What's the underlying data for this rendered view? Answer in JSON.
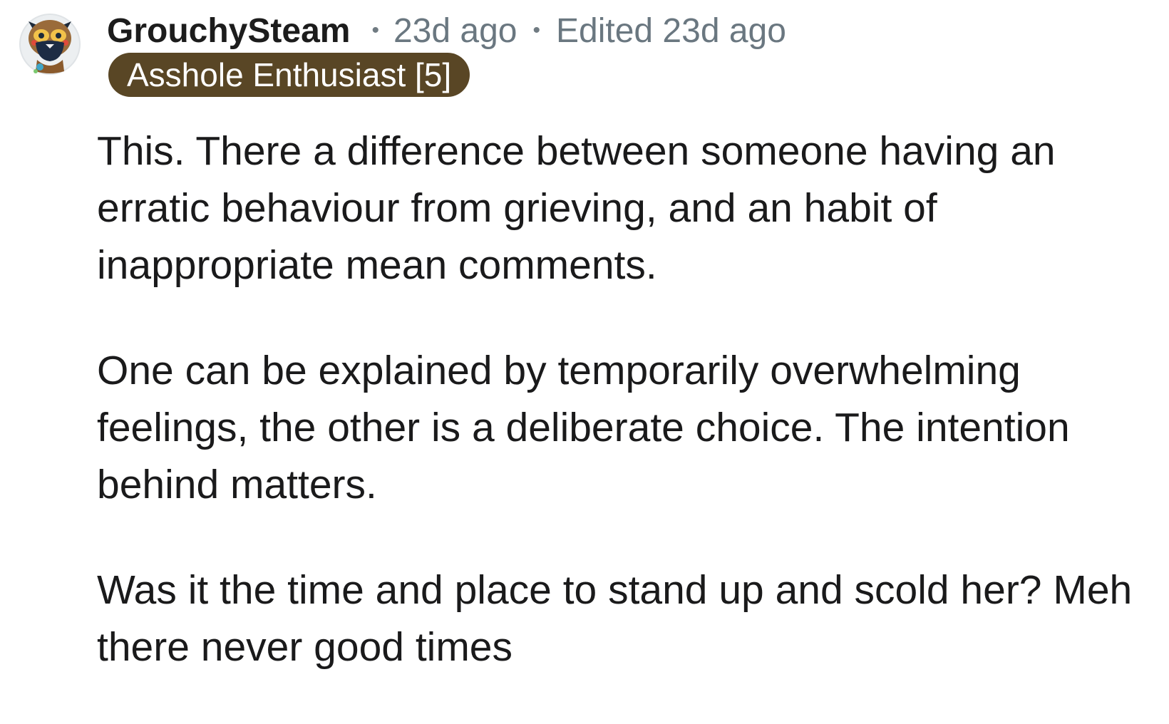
{
  "comment": {
    "author": "GrouchySteam",
    "avatar_icon": "owl-avatar-icon",
    "separator": "•",
    "posted": "23d ago",
    "edited": "Edited 23d ago",
    "flair": "Asshole Enthusiast [5]",
    "paragraphs": [
      "This. There a difference between someone having an erratic behaviour from grieving, and an habit of inappropriate mean comments.",
      "One can be explained by temporarily overwhelming feelings, the other is a deliberate choice. The intention behind matters.",
      "Was it the time and place to stand up and scold her? Meh there never good times"
    ]
  },
  "colors": {
    "flair_background": "#594625",
    "meta_text": "#6a7780",
    "body_text": "#1a1a1b"
  }
}
